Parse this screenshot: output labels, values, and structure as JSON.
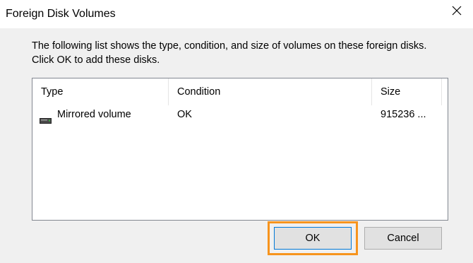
{
  "window": {
    "title": "Foreign Disk Volumes",
    "close_icon": "close-icon"
  },
  "description": "The following list shows the type, condition, and size of volumes on these foreign disks. Click OK to add these disks.",
  "volumes_list": {
    "columns": [
      "Type",
      "Condition",
      "Size"
    ],
    "rows": [
      {
        "icon": "disk-volume-icon",
        "type": "Mirrored volume",
        "condition": "OK",
        "size": "915236 ..."
      }
    ]
  },
  "buttons": {
    "ok_label": "OK",
    "cancel_label": "Cancel"
  },
  "colors": {
    "highlight": "#f7941d",
    "focus_border": "#0078d7",
    "button_face": "#e1e1e1",
    "dialog_bg": "#f0f0f0"
  }
}
